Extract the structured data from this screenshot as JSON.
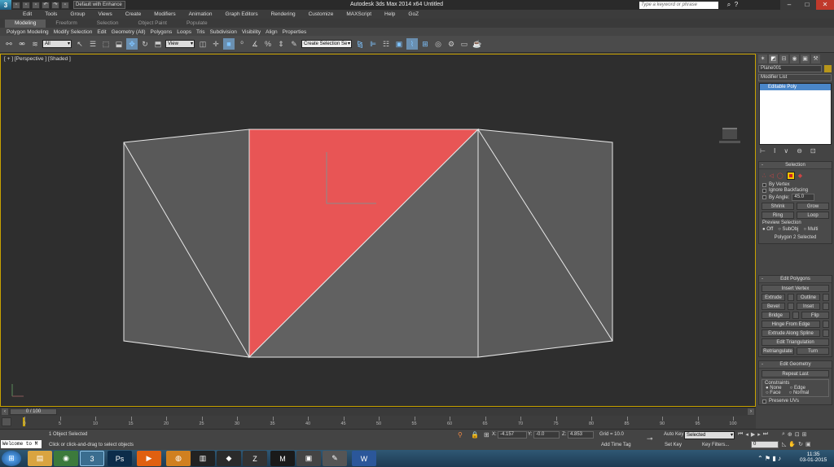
{
  "titlebar": {
    "workspace": "Default with Enhance ▾",
    "app_title": "Autodesk 3ds Max 2014 x64     Untitled",
    "search_placeholder": "Type a keyword or phrase",
    "logo_icon": "3ds-max-logo-icon"
  },
  "menu": [
    "Edit",
    "Tools",
    "Group",
    "Views",
    "Create",
    "Modifiers",
    "Animation",
    "Graph Editors",
    "Rendering",
    "Customize",
    "MAXScript",
    "Help",
    "GoZ"
  ],
  "ribbon": {
    "tabs": [
      "Modeling",
      "Freeform",
      "Selection",
      "Object Paint",
      "Populate"
    ],
    "active_tab": "Modeling",
    "sub_items": [
      "Polygon Modeling",
      "Modify Selection",
      "Edit",
      "Geometry (All)",
      "Polygons",
      "Loops",
      "Tris",
      "Subdivision",
      "Visibility",
      "Align",
      "Properties"
    ]
  },
  "toolbar": {
    "filter": "All",
    "ref_coord": "View",
    "named_selection": "Create Selection Se"
  },
  "viewport": {
    "label": "[ + ] [Perspective ] [Shaded ]",
    "selection_color": "#e85555",
    "frame_color": "#c8a200"
  },
  "command_panel": {
    "object_name": "Plane001",
    "object_color": "#b8961a",
    "modifier_list": "Modifier List",
    "stack_item": "Editable Poly",
    "selection": {
      "title": "Selection",
      "by_vertex": "By Vertex",
      "ignore_backfacing": "Ignore Backfacing",
      "by_angle": "By Angle:",
      "angle_value": "45.0",
      "shrink": "Shrink",
      "grow": "Grow",
      "ring": "Ring",
      "loop": "Loop",
      "preview_selection": "Preview Selection",
      "preview_off": "Off",
      "preview_subobj": "SubObj",
      "preview_multi": "Multi",
      "status": "Polygon 2 Selected"
    },
    "edit_polygons": {
      "title": "Edit Polygons",
      "insert_vertex": "Insert Vertex",
      "extrude": "Extrude",
      "outline": "Outline",
      "bevel": "Bevel",
      "inset": "Inset",
      "bridge": "Bridge",
      "flip": "Flip",
      "hinge": "Hinge From Edge",
      "extrude_spline": "Extrude Along Spline",
      "edit_triangulation": "Edit Triangulation",
      "retriangulate": "Retriangulate",
      "turn": "Turn"
    },
    "edit_geometry": {
      "title": "Edit Geometry",
      "repeat_last": "Repeat Last",
      "constraints": "Constraints",
      "none": "None",
      "edge": "Edge",
      "face": "Face",
      "normal": "Normal",
      "preserve_uvs": "Preserve UVs"
    }
  },
  "timeslider": {
    "label": "0 / 100",
    "ticks": [
      "0",
      "5",
      "10",
      "15",
      "20",
      "25",
      "30",
      "35",
      "40",
      "45",
      "50",
      "55",
      "60",
      "65",
      "70",
      "75",
      "80",
      "85",
      "90",
      "95",
      "100"
    ]
  },
  "status": {
    "maxscript": "Welcome to M",
    "objects": "1 Object Selected",
    "prompt": "Click or click-and-drag to select objects",
    "x_label": "X:",
    "x": "-4.157",
    "y_label": "Y:",
    "y": "-0.0",
    "z_label": "Z:",
    "z": "4.853",
    "grid": "Grid = 10.0",
    "add_time_tag": "Add Time Tag",
    "auto_key": "Auto Key",
    "auto_key_value": "Selected",
    "set_key": "Set Key",
    "key_filters": "Key Filters...",
    "frame": "0"
  },
  "taskbar": {
    "time": "11:35",
    "date": "03-01-2015",
    "apps": [
      "start-orb-icon",
      "folder-icon",
      "chrome-icon",
      "3dsmax-icon",
      "photoshop-icon",
      "media-player-icon",
      "unity-icon",
      "terminal-icon",
      "zbrush-icon",
      "after-effects-icon",
      "xd-icon",
      "filezilla-icon",
      "paint-icon",
      "word-icon"
    ]
  }
}
